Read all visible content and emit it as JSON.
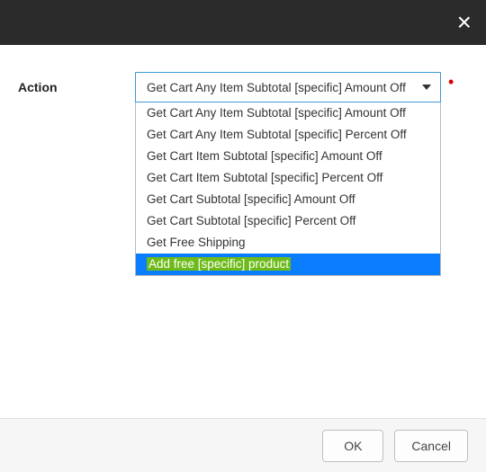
{
  "header": {
    "close_label": "×"
  },
  "form": {
    "action_label": "Action",
    "selected_value": "Get Cart Any Item Subtotal [specific] Amount Off",
    "required_marker": "•"
  },
  "options": [
    {
      "label": "Get Cart Any Item Subtotal [specific] Amount Off",
      "highlighted": false
    },
    {
      "label": "Get Cart Any Item Subtotal [specific] Percent Off",
      "highlighted": false
    },
    {
      "label": "Get Cart Item Subtotal [specific] Amount Off",
      "highlighted": false
    },
    {
      "label": "Get Cart Item Subtotal [specific] Percent Off",
      "highlighted": false
    },
    {
      "label": "Get Cart Subtotal [specific] Amount Off",
      "highlighted": false
    },
    {
      "label": "Get Cart Subtotal [specific] Percent Off",
      "highlighted": false
    },
    {
      "label": "Get Free Shipping",
      "highlighted": false
    },
    {
      "label": "Add free [specific] product",
      "highlighted": true
    }
  ],
  "footer": {
    "ok_label": "OK",
    "cancel_label": "Cancel"
  }
}
